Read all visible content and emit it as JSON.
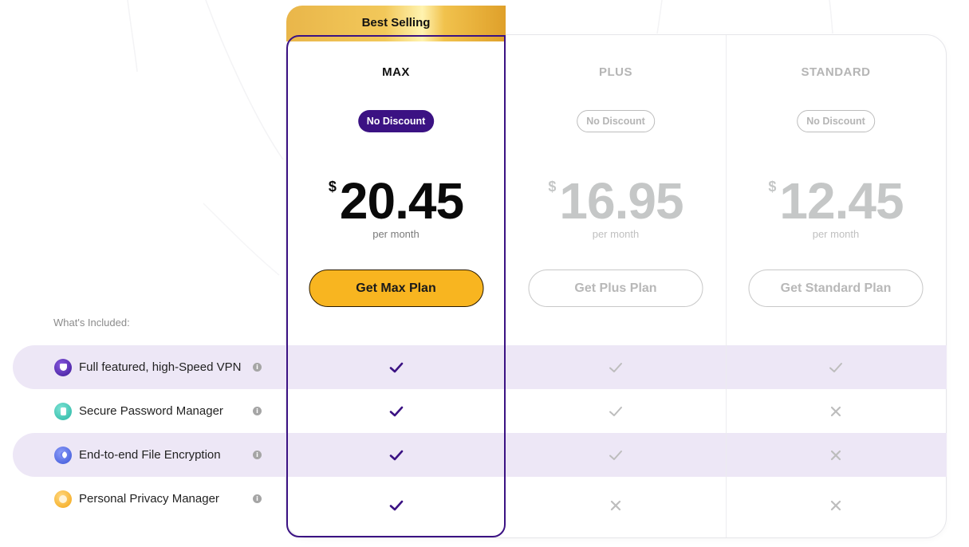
{
  "ribbon": {
    "label": "Best Selling"
  },
  "included_label": "What's Included:",
  "features": [
    {
      "name": "Full featured, high-Speed VPN",
      "icon": "vpn-shield-icon",
      "info_icon": "i"
    },
    {
      "name": "Secure Password Manager",
      "icon": "password-manager-icon",
      "info_icon": "i"
    },
    {
      "name": "End-to-end File Encryption",
      "icon": "file-encryption-icon",
      "info_icon": "i"
    },
    {
      "name": "Personal Privacy Manager",
      "icon": "privacy-manager-icon",
      "info_icon": "i"
    }
  ],
  "plans": [
    {
      "name": "MAX",
      "badge": "No Discount",
      "currency": "$",
      "price": "20.45",
      "period": "per month",
      "button": "Get Max Plan",
      "featured": true,
      "includes": [
        true,
        true,
        true,
        true
      ]
    },
    {
      "name": "PLUS",
      "badge": "No Discount",
      "currency": "$",
      "price": "16.95",
      "period": "per month",
      "button": "Get Plus Plan",
      "featured": false,
      "includes": [
        true,
        true,
        true,
        false
      ]
    },
    {
      "name": "STANDARD",
      "badge": "No Discount",
      "currency": "$",
      "price": "12.45",
      "period": "per month",
      "button": "Get Standard Plan",
      "featured": false,
      "includes": [
        true,
        false,
        false,
        false
      ]
    }
  ],
  "colors": {
    "accent_purple": "#3b1283",
    "accent_gold": "#f8b520",
    "stripe": "#ede7f6",
    "check_muted": "#bdbdbd"
  }
}
